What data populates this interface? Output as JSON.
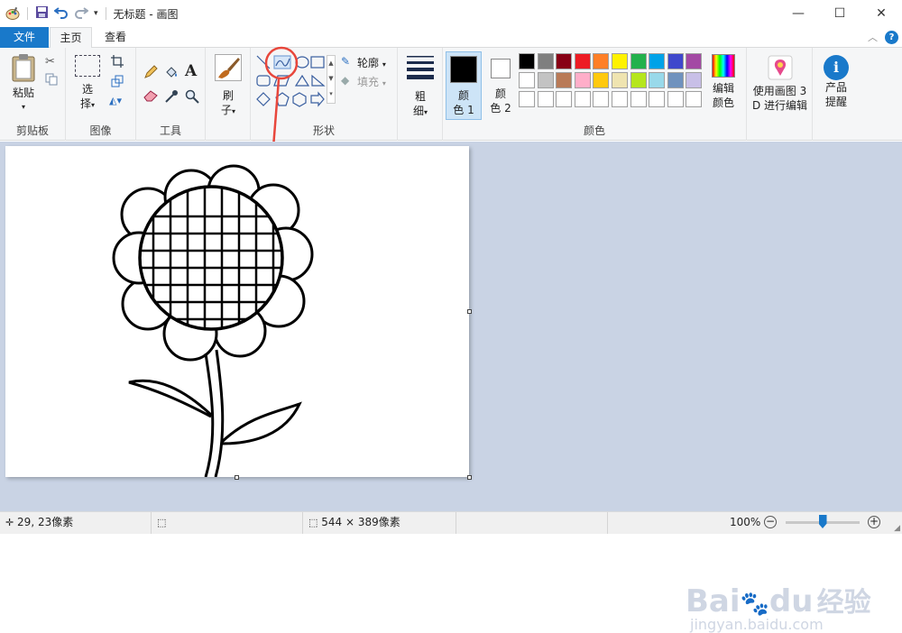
{
  "window": {
    "title": "无标题 - 画图",
    "minimize": "—",
    "maximize": "☐",
    "close": "✕"
  },
  "tabs": {
    "file": "文件",
    "home": "主页",
    "view": "查看"
  },
  "ribbon": {
    "clipboard": {
      "paste": "粘贴",
      "label": "剪贴板"
    },
    "image": {
      "select_1": "选",
      "select_2": "择",
      "label": "图像"
    },
    "tools": {
      "label": "工具"
    },
    "brushes": {
      "label_1": "刷",
      "label_2": "子"
    },
    "shapes": {
      "outline": "轮廓",
      "fill": "填充",
      "label": "形状"
    },
    "size": {
      "label_1": "粗",
      "label_2": "细"
    },
    "colors": {
      "color1_a": "颜",
      "color1_b": "色 1",
      "color2_a": "颜",
      "color2_b": "色 2",
      "edit_a": "编辑",
      "edit_b": "颜色",
      "label": "颜色",
      "palette_row1": [
        "#000000",
        "#7f7f7f",
        "#880015",
        "#ed1c24",
        "#ff7f27",
        "#fff200",
        "#22b14c",
        "#00a2e8",
        "#3f48cc",
        "#a349a4"
      ],
      "palette_row2": [
        "#ffffff",
        "#c3c3c3",
        "#b97a57",
        "#ffaec9",
        "#ffc90e",
        "#efe4b0",
        "#b5e61d",
        "#99d9ea",
        "#7092be",
        "#c8bfe7"
      ],
      "primary": "#000000",
      "secondary": "#ffffff"
    },
    "paint3d": {
      "line1": "使用画图 3",
      "line2": "D 进行编辑"
    },
    "product": {
      "line1": "产品",
      "line2": "提醒"
    }
  },
  "status": {
    "cursor_pos": "29, 23像素",
    "canvas_size": "544 × 389像素",
    "zoom": "100%",
    "zoom_level": 0.5
  },
  "watermark": {
    "brand": "Bai",
    "brand2": "du",
    "cn": "经验",
    "url": "jingyan.baidu.com"
  }
}
